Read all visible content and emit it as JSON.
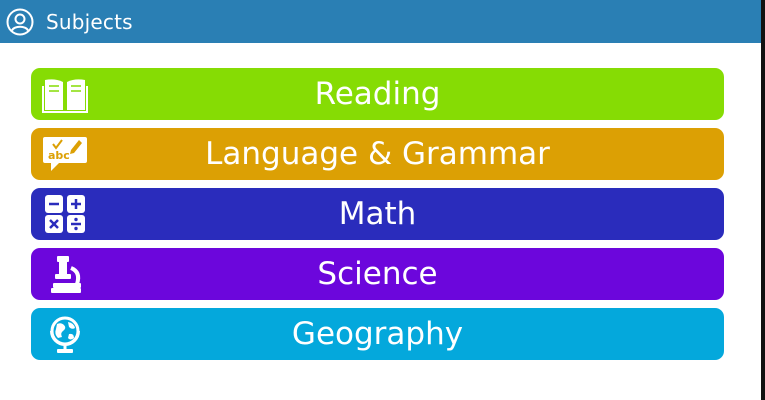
{
  "header": {
    "title": "Subjects",
    "icon": "user-circle-icon",
    "background": "#2a7fb4"
  },
  "subjects": [
    {
      "label": "Reading",
      "icon": "open-book-icon",
      "color": "#86dc04"
    },
    {
      "label": "Language & Grammar",
      "icon": "abc-speech-bubble-icon",
      "color": "#dca004"
    },
    {
      "label": "Math",
      "icon": "math-operators-icon",
      "color": "#2a2cbc"
    },
    {
      "label": "Science",
      "icon": "microscope-icon",
      "color": "#6c06dc"
    },
    {
      "label": "Geography",
      "icon": "globe-icon",
      "color": "#04a8dc"
    }
  ]
}
